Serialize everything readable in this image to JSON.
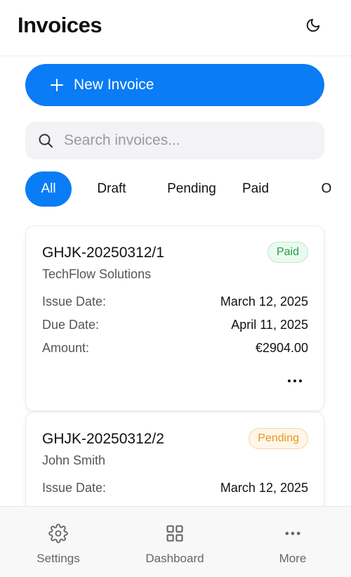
{
  "header": {
    "title": "Invoices",
    "theme_icon": "moon-icon"
  },
  "actions": {
    "new_invoice_label": "New Invoice"
  },
  "search": {
    "placeholder": "Search invoices...",
    "value": ""
  },
  "filters": {
    "items": [
      {
        "label": "All",
        "active": true
      },
      {
        "label": "Draft",
        "active": false
      },
      {
        "label": "Pending",
        "active": false
      },
      {
        "label": "Paid",
        "active": false
      },
      {
        "label": "O",
        "active": false
      }
    ]
  },
  "invoices": [
    {
      "number": "GHJK-20250312/1",
      "client": "TechFlow Solutions",
      "status": "Paid",
      "issue_label": "Issue Date:",
      "issue_date": "March 12, 2025",
      "due_label": "Due Date:",
      "due_date": "April 11, 2025",
      "amount_label": "Amount:",
      "amount": "€2904.00"
    },
    {
      "number": "GHJK-20250312/2",
      "client": "John Smith",
      "status": "Pending",
      "issue_label": "Issue Date:",
      "issue_date": "March 12, 2025"
    }
  ],
  "bottom_nav": {
    "items": [
      {
        "label": "Settings",
        "icon": "gear-icon"
      },
      {
        "label": "Dashboard",
        "icon": "grid-icon"
      },
      {
        "label": "More",
        "icon": "more-icon"
      }
    ]
  },
  "colors": {
    "accent": "#0a7cf5",
    "paid": "#22a045",
    "pending": "#e9961d"
  }
}
